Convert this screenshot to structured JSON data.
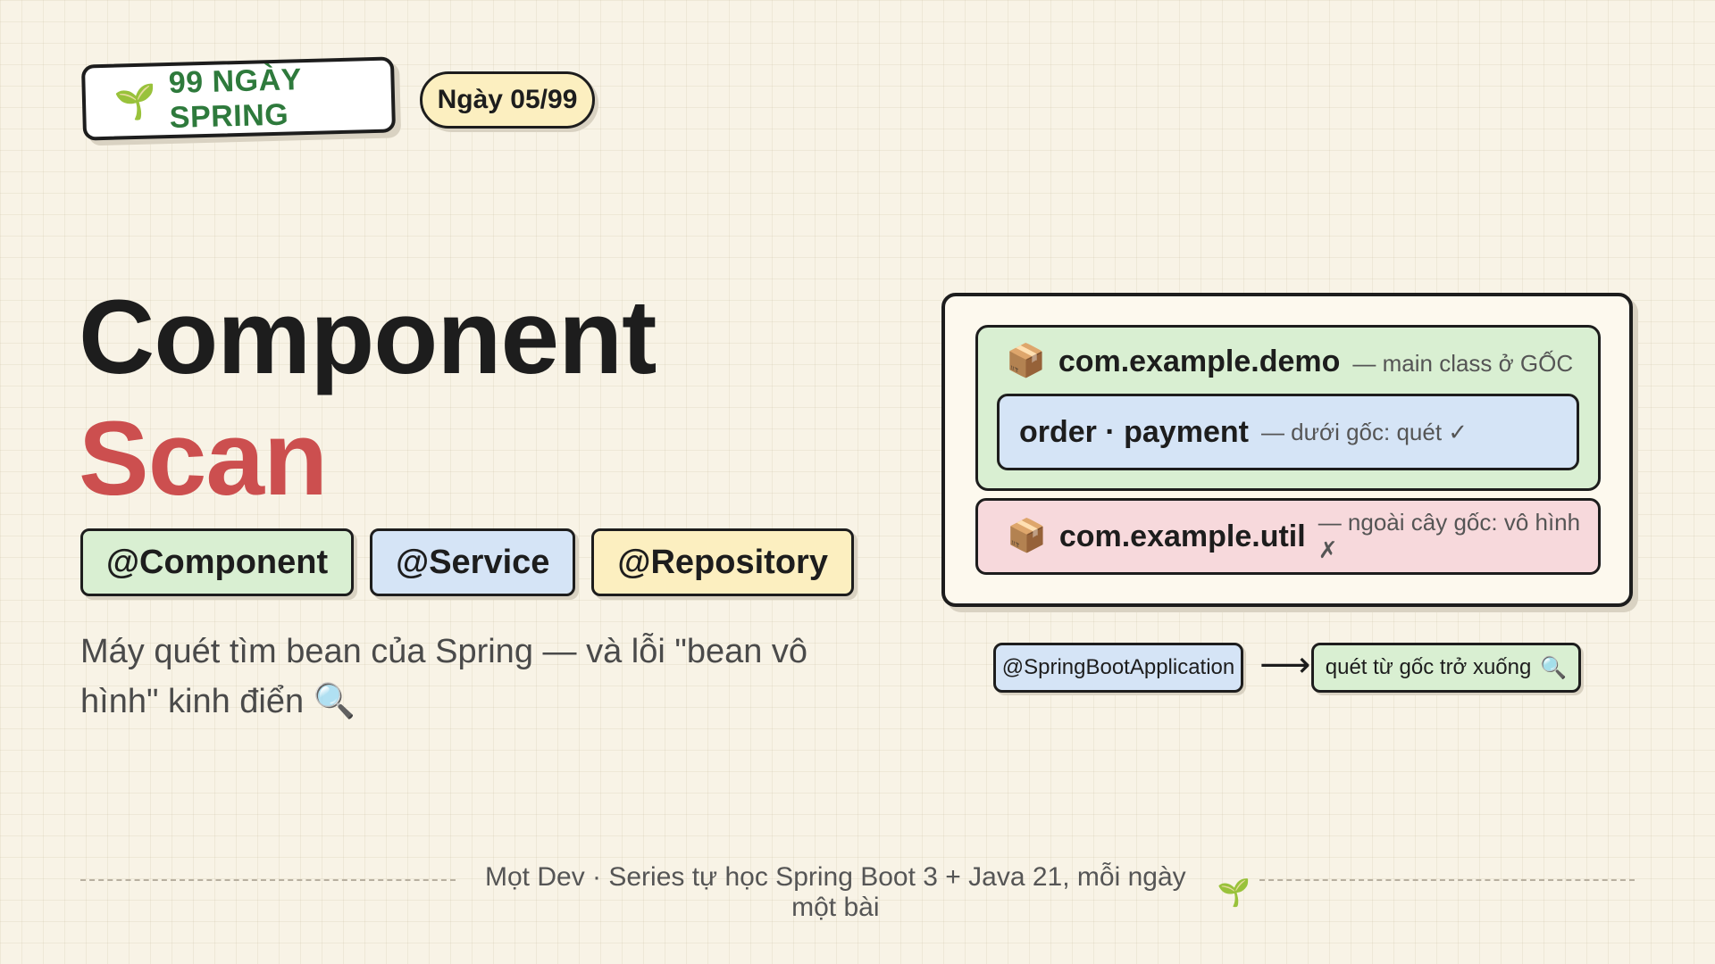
{
  "header": {
    "series_icon": "sprout-icon",
    "series_label": "99 NGÀY SPRING",
    "day_label": "Ngày 05/99"
  },
  "title": {
    "line1": "Component",
    "line2": "Scan"
  },
  "annotations": [
    {
      "label": "@Component",
      "color": "#d9efd2"
    },
    {
      "label": "@Service",
      "color": "#d5e4f6"
    },
    {
      "label": "@Repository",
      "color": "#fcefc0"
    }
  ],
  "subtitle": {
    "text": "Máy quét tìm bean của Spring — và lỗi \"bean vô hình\" kinh điển",
    "icon": "magnifier-icon"
  },
  "diagram": {
    "root_package": {
      "icon": "package-icon",
      "name": "com.example.demo",
      "note": "— main class ở GỐC"
    },
    "child_package": {
      "name": "order · payment",
      "note": "— dưới gốc: quét ✓"
    },
    "outside_package": {
      "icon": "package-icon",
      "name": "com.example.util",
      "note": "— ngoài cây gốc: vô hình ✗"
    }
  },
  "flow": {
    "source": "@SpringBootApplication",
    "arrow": "⟶",
    "result": "quét từ gốc trở xuống",
    "result_icon": "magnifier-icon"
  },
  "footer": {
    "text": "Mọt Dev · Series tự học Spring Boot 3 + Java 21, mỗi ngày một bài",
    "icon": "sprout-icon"
  },
  "colors": {
    "background": "#f8f3e6",
    "accent_red": "#cc4f4f",
    "accent_green": "#2e7a3c",
    "green": "#d9efd2",
    "blue": "#d5e4f6",
    "yellow": "#fcefc0",
    "pink": "#f7d9dc"
  }
}
